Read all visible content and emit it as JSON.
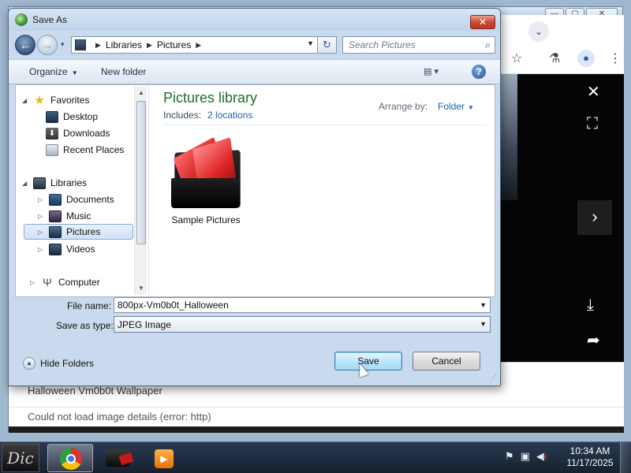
{
  "dialog": {
    "title": "Save As",
    "close_label": "✕",
    "nav": {
      "back_label": "←",
      "forward_label": "→",
      "history_label": "▾",
      "address_parts": [
        "Libraries",
        "Pictures"
      ],
      "refresh_label": "↻",
      "search_placeholder": "Search Pictures"
    },
    "commands": {
      "organize": "Organize",
      "new_folder": "New folder",
      "view_label": "▤ ▾",
      "help_label": "?"
    },
    "nav_pane": {
      "items": [
        {
          "label": "Favorites",
          "icon": "star-icon"
        },
        {
          "label": "Desktop",
          "icon": "desktop-icon"
        },
        {
          "label": "Downloads",
          "icon": "downloads-icon"
        },
        {
          "label": "Recent Places",
          "icon": "recent-places-icon"
        },
        {
          "label": "Libraries",
          "icon": "libraries-icon"
        },
        {
          "label": "Documents",
          "icon": "documents-icon"
        },
        {
          "label": "Music",
          "icon": "music-icon"
        },
        {
          "label": "Pictures",
          "icon": "pictures-icon",
          "selected": true
        },
        {
          "label": "Videos",
          "icon": "videos-icon"
        },
        {
          "label": "Computer",
          "icon": "computer-icon"
        }
      ]
    },
    "library": {
      "title": "Pictures library",
      "includes_label": "Includes:",
      "includes_link": "2 locations",
      "arrange_label": "Arrange by:",
      "arrange_value": "Folder",
      "items": [
        {
          "label": "Sample Pictures",
          "icon": "folder-icon"
        }
      ]
    },
    "file_name": {
      "label": "File name:",
      "value": "800px-Vm0b0t_Halloween"
    },
    "save_as_type": {
      "label": "Save as type:",
      "value": "JPEG Image"
    },
    "hide_folders_label": "Hide Folders",
    "save_label": "Save",
    "cancel_label": "Cancel"
  },
  "browser": {
    "page_caption": "Halloween Vm0b0t Wallpaper",
    "error_text": "Could not load image details (error: http)"
  },
  "taskbar": {
    "start_label": "Dic",
    "time": "10:34 AM",
    "date": "11/17/2025"
  },
  "colors": {
    "library_title": "#1e6e2c",
    "link": "#1e5fb3",
    "close_button": "#c8442d"
  }
}
